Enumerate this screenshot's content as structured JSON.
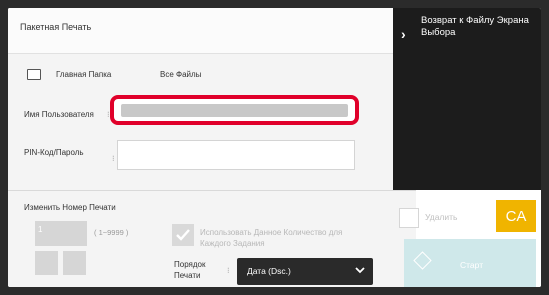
{
  "header": {
    "title": "Пакетная Печать",
    "return_label": "Возврат к Файлу Экрана Выбора"
  },
  "location": {
    "folder": "Главная Папка",
    "filter": "Все Файлы"
  },
  "form": {
    "user_label": "Имя Пользователя",
    "user_required": "⁝",
    "user_value": "",
    "pin_label": "PIN-Код/Пароль",
    "pin_required": "⁝",
    "pin_value": ""
  },
  "print_settings": {
    "change_label": "Изменить Номер Печати",
    "copies": "1",
    "range": "( 1~9999 )",
    "use_count_label": "Использовать Данное Количество для Каждого Задания",
    "order_label": "Порядок Печати",
    "order_required": "⁝",
    "order_value": "Дата (Dsc.)"
  },
  "actions": {
    "delete_label": "Удалить",
    "ca_label": "CA",
    "start_label": "Старт"
  },
  "colors": {
    "highlight": "#e0002a",
    "ca": "#f0b400",
    "start": "#cfe8ea",
    "dark": "#1c1c1c"
  },
  "icons": [
    "folder-icon",
    "chevron-right-icon",
    "chevron-down-icon",
    "check-icon",
    "start-diamond-icon"
  ]
}
